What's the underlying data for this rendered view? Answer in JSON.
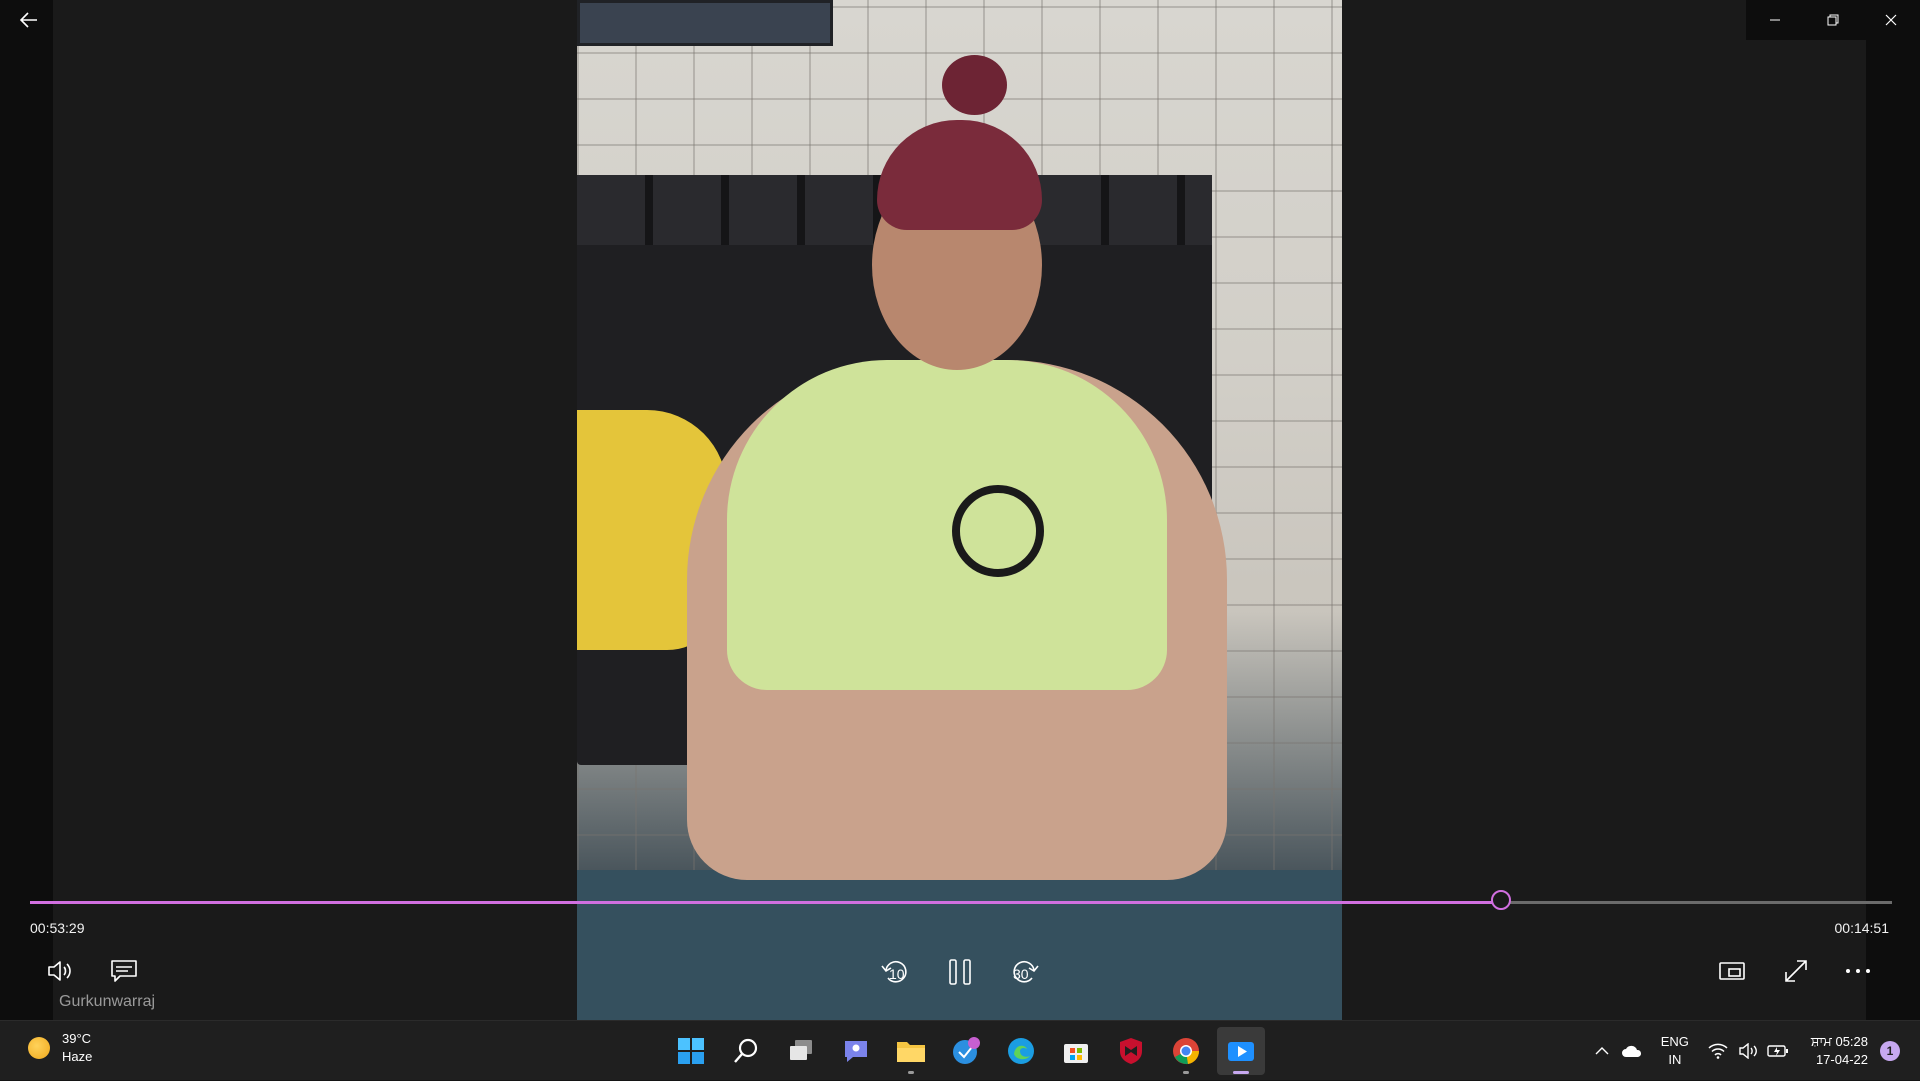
{
  "window": {
    "back_icon": "arrow-left-icon",
    "controls": [
      {
        "name": "minimize",
        "icon": "minimize-icon"
      },
      {
        "name": "restore",
        "icon": "restore-icon"
      },
      {
        "name": "close",
        "icon": "close-icon"
      }
    ]
  },
  "player": {
    "progress": 0.79,
    "accent": "#d16fe0",
    "time_elapsed": "00:53:29",
    "time_remaining": "00:14:51",
    "media_title": "Gurkunwarraj",
    "skip_back_label": "10",
    "skip_forward_label": "30",
    "controls": {
      "volume_icon": "volume-icon",
      "captions_icon": "captions-icon",
      "skip_back_icon": "skip-back-icon",
      "pause_icon": "pause-icon",
      "skip_forward_icon": "skip-forward-icon",
      "miniplayer_icon": "miniplayer-icon",
      "fullscreen_icon": "fullscreen-icon",
      "more_icon": "more-icon"
    }
  },
  "taskbar": {
    "weather": {
      "temp": "39°C",
      "condition": "Haze",
      "icon": "sun-haze-icon"
    },
    "apps": [
      {
        "name": "start",
        "icon": "windows-start-icon"
      },
      {
        "name": "search",
        "icon": "search-icon"
      },
      {
        "name": "task-view",
        "icon": "task-view-icon"
      },
      {
        "name": "chat",
        "icon": "chat-icon"
      },
      {
        "name": "file-explorer",
        "icon": "folder-icon"
      },
      {
        "name": "mail-app",
        "icon": "mail-icon"
      },
      {
        "name": "edge",
        "icon": "edge-icon"
      },
      {
        "name": "store",
        "icon": "store-icon"
      },
      {
        "name": "mcafee",
        "icon": "shield-icon"
      },
      {
        "name": "chrome",
        "icon": "chrome-icon"
      },
      {
        "name": "media-player",
        "icon": "media-player-icon"
      }
    ],
    "tray": {
      "language_line1": "ENG",
      "language_line2": "IN",
      "time": "ਸ਼ਾਮ 05:28",
      "date": "17-04-22",
      "notification_count": "1"
    }
  }
}
